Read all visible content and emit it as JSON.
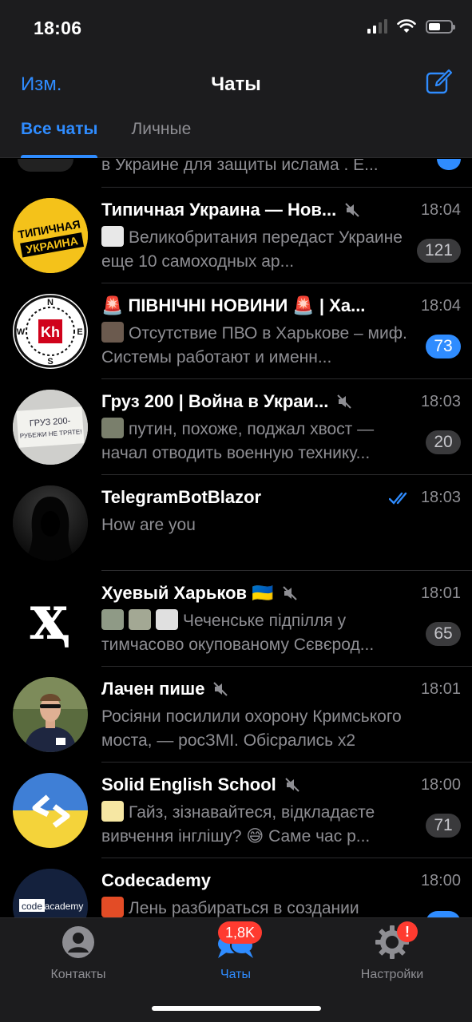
{
  "status_bar": {
    "time": "18:06"
  },
  "header": {
    "edit_label": "Изм.",
    "title": "Чаты",
    "tabs": [
      {
        "label": "Все чаты",
        "active": true
      },
      {
        "label": "Личные",
        "active": false
      }
    ]
  },
  "partial_chat": {
    "preview": "в Украине для защиты ислама . Е..."
  },
  "chats": [
    {
      "name": "Типичная Украина — Нов...",
      "muted": true,
      "time": "18:04",
      "preview": "Великобритания передаст Украине еще 10 самоходных ар...",
      "unread": "121",
      "badge_style": "muted",
      "avatar": {
        "kind": "typical",
        "line1": "ТИПИЧНАЯ",
        "line2": "УКРАИНА"
      }
    },
    {
      "name": "🚨 ПІВНІЧНІ НОВИНИ 🚨 | Ха...",
      "muted": false,
      "time": "18:04",
      "preview": "Отсутствие ПВО в Харькове – миф. Системы работают и именн...",
      "unread": "73",
      "badge_style": "blue",
      "avatar": {
        "kind": "compass",
        "center": "Kh",
        "n": "N",
        "s": "S",
        "w": "W",
        "e": "E"
      }
    },
    {
      "name": "Груз 200 | Война в Украи...",
      "muted": true,
      "time": "18:03",
      "preview": "путин, похоже, поджал хвост — начал отводить военную технику...",
      "unread": "20",
      "badge_style": "muted",
      "avatar": {
        "kind": "paper",
        "line1": "ГРУЗ 200-",
        "line2": "РУБЕЖИ НЕ ТРЯТЕ!"
      }
    },
    {
      "name": "TelegramBotBlazor",
      "muted": false,
      "time": "18:03",
      "read": true,
      "preview": "How are you",
      "unread": "",
      "badge_style": "none",
      "avatar": {
        "kind": "hood"
      }
    },
    {
      "name": "Хуевый Харьков 🇺🇦",
      "muted": true,
      "time": "18:01",
      "preview": "Чеченське підпілля у тимчасово окупованому Сєвєрод...",
      "unread": "65",
      "badge_style": "muted",
      "avatar": {
        "kind": "glyph",
        "glyph": "ҳ"
      }
    },
    {
      "name": "Лачен пише",
      "muted": true,
      "time": "18:01",
      "preview": "Росіяни посилили охорону Кримського моста, — росЗМІ. Обісрались х2",
      "unread": "",
      "badge_style": "none",
      "avatar": {
        "kind": "photo"
      }
    },
    {
      "name": "Solid English School",
      "muted": true,
      "time": "18:00",
      "preview": "Гайз, зізнавайтеся, відкладаєте вивчення інглішу? 😅 Саме час р...",
      "unread": "71",
      "badge_style": "muted",
      "avatar": {
        "kind": "flag-code",
        "glyph": "<>"
      }
    },
    {
      "name": "Codecademy",
      "muted": false,
      "time": "18:00",
      "preview": "Лень разбираться в создании",
      "unread": "",
      "badge_style": "none",
      "avatar": {
        "kind": "codecademy",
        "text1": "code",
        "text2": "academy"
      }
    }
  ],
  "tab_bar": {
    "items": [
      {
        "label": "Контакты",
        "active": false,
        "icon": "person-icon"
      },
      {
        "label": "Чаты",
        "active": true,
        "icon": "chat-bubbles-icon",
        "badge": "1,8K"
      },
      {
        "label": "Настройки",
        "active": false,
        "icon": "gear-icon",
        "badge": "!"
      }
    ]
  },
  "colors": {
    "accent": "#2f8cff",
    "background": "#000000",
    "bar": "#1c1c1e",
    "badge_red": "#ff3b30"
  }
}
